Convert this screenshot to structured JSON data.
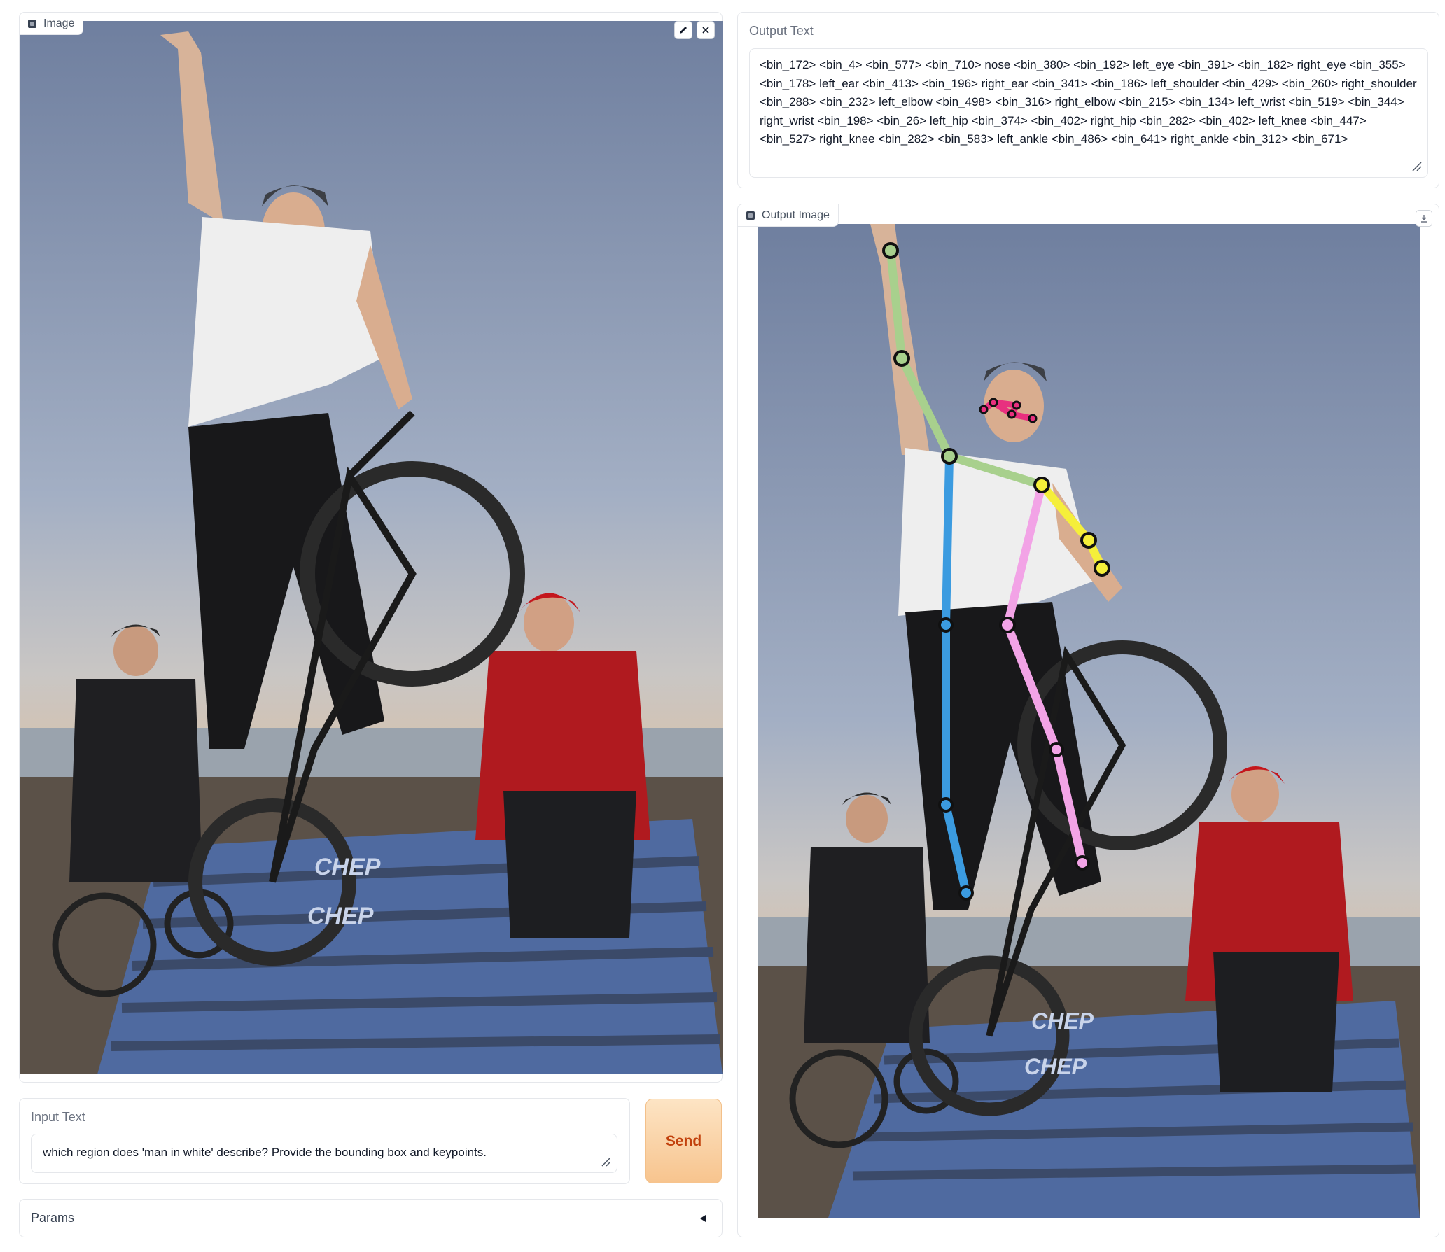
{
  "input_image": {
    "label": "Image",
    "edit_icon": "pencil-icon",
    "close_icon": "close-icon"
  },
  "output_text": {
    "label": "Output Text",
    "value": "<bin_172> <bin_4> <bin_577> <bin_710> nose <bin_380> <bin_192> left_eye <bin_391> <bin_182> right_eye <bin_355> <bin_178> left_ear <bin_413> <bin_196> right_ear <bin_341> <bin_186> left_shoulder <bin_429> <bin_260> right_shoulder <bin_288> <bin_232> left_elbow <bin_498> <bin_316> right_elbow <bin_215> <bin_134> left_wrist <bin_519> <bin_344> right_wrist <bin_198> <bin_26> left_hip <bin_374> <bin_402> right_hip <bin_282> <bin_402> left_knee <bin_447> <bin_527> right_knee <bin_282> <bin_583> left_ankle <bin_486> <bin_641> right_ankle <bin_312> <bin_671>"
  },
  "output_image": {
    "label": "Output Image",
    "download_icon": "download-icon",
    "keypoint_colors": {
      "head": "#e8307f",
      "right_arm": "#a8d08d",
      "left_arm": "#f5ef3a",
      "right_side": "#3b9be0",
      "left_side": "#f2a3e6"
    }
  },
  "input_text": {
    "label": "Input Text",
    "value": "which region does 'man in white' describe? Provide the bounding box and keypoints."
  },
  "send_button": {
    "label": "Send"
  },
  "params": {
    "label": "Params",
    "toggle_icon": "caret-left-icon"
  }
}
